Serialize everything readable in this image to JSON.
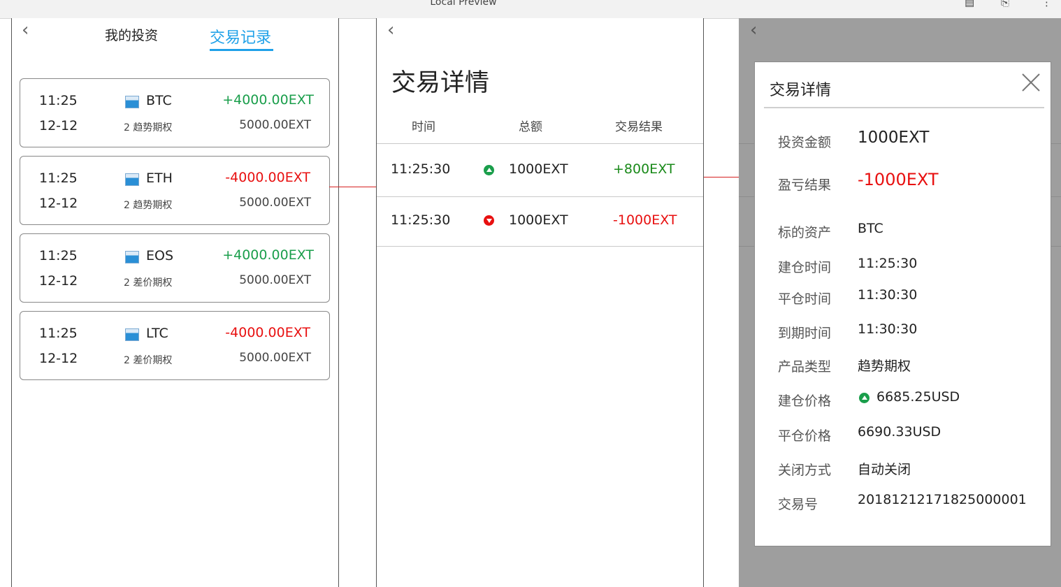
{
  "window": {
    "title": "Local Preview"
  },
  "panel1": {
    "tabs": [
      {
        "label": "我的投资"
      },
      {
        "label": "交易记录"
      }
    ],
    "cards": [
      {
        "time": "11:25",
        "date": "12-12",
        "coin": "BTC",
        "type": "2 趋势期权",
        "pl": "+4000.00EXT",
        "pl_color": "#1a9e4b",
        "amount": "5000.00EXT"
      },
      {
        "time": "11:25",
        "date": "12-12",
        "coin": "ETH",
        "type": "2 趋势期权",
        "pl": "-4000.00EXT",
        "pl_color": "#e81010",
        "amount": "5000.00EXT"
      },
      {
        "time": "11:25",
        "date": "12-12",
        "coin": "EOS",
        "type": "2 差价期权",
        "pl": "+4000.00EXT",
        "pl_color": "#1a9e4b",
        "amount": "5000.00EXT"
      },
      {
        "time": "11:25",
        "date": "12-12",
        "coin": "LTC",
        "type": "2 差价期权",
        "pl": "-4000.00EXT",
        "pl_color": "#e81010",
        "amount": "5000.00EXT"
      }
    ]
  },
  "panel2": {
    "title": "交易详情",
    "headers": [
      "时间",
      "总额",
      "交易结果"
    ],
    "rows": [
      {
        "time": "11:25:30",
        "direction": "up",
        "total": "1000EXT",
        "result": "+800EXT",
        "result_color": "#1a8a1a"
      },
      {
        "time": "11:25:30",
        "direction": "down",
        "total": "1000EXT",
        "result": "-1000EXT",
        "result_color": "#e81010"
      }
    ]
  },
  "modal": {
    "title": "交易详情",
    "fields": [
      {
        "label": "投资金额",
        "value": "1000EXT"
      },
      {
        "label": "盈亏结果",
        "value": "-1000EXT"
      },
      {
        "label": "标的资产",
        "value": "BTC"
      },
      {
        "label": "建仓时间",
        "value": "11:25:30"
      },
      {
        "label": "平仓时间",
        "value": "11:30:30"
      },
      {
        "label": "到期时间",
        "value": "11:30:30"
      },
      {
        "label": "产品类型",
        "value": "趋势期权"
      },
      {
        "label": "建仓价格",
        "value": "6685.25USD"
      },
      {
        "label": "平仓价格",
        "value": "6690.33USD"
      },
      {
        "label": "关闭方式",
        "value": "自动关闭"
      },
      {
        "label": "交易号",
        "value": "20181212171825000001"
      }
    ]
  },
  "colors": {
    "accent": "#1fa1e8",
    "up": "#1a9e4b",
    "down": "#e81010",
    "connector": "#d62020"
  },
  "icons": [
    "back-chevron-icon",
    "image-placeholder-icon",
    "triangle-up-icon",
    "triangle-down-icon",
    "close-icon",
    "document-icon",
    "bookmark-icon",
    "more-icon"
  ]
}
